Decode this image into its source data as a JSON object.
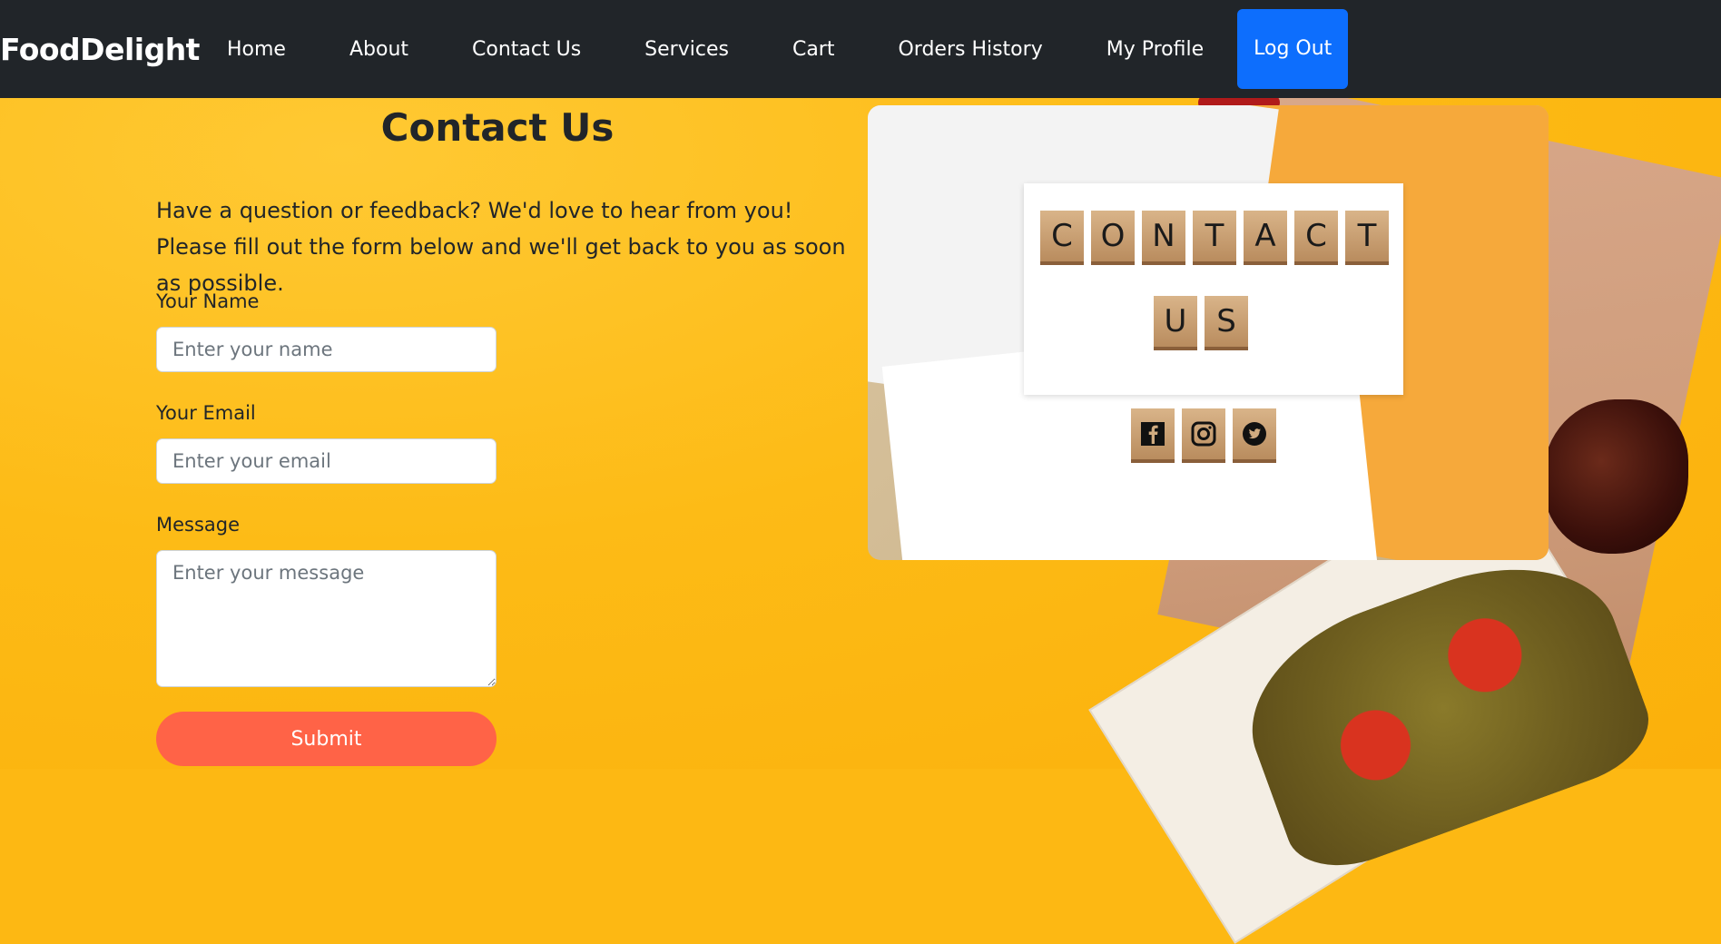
{
  "nav": {
    "brand": "FoodDelight",
    "items": [
      {
        "label": "Home"
      },
      {
        "label": "About"
      },
      {
        "label": "Contact Us"
      },
      {
        "label": "Services"
      },
      {
        "label": "Cart"
      },
      {
        "label": "Orders History"
      },
      {
        "label": "My Profile"
      }
    ],
    "logout_label": "Log Out"
  },
  "contact": {
    "title": "Contact Us",
    "intro": "Have a question or feedback? We'd love to hear from you! Please fill out the form below and we'll get back to you as soon as possible.",
    "name_label": "Your Name",
    "name_placeholder": "Enter your name",
    "email_label": "Your Email",
    "email_placeholder": "Enter your email",
    "message_label": "Message",
    "message_placeholder": "Enter your message",
    "submit_label": "Submit"
  },
  "image": {
    "tiles_row1": [
      "C",
      "O",
      "N",
      "T",
      "A",
      "C",
      "T"
    ],
    "tiles_row2": [
      "U",
      "S"
    ],
    "social_icons": [
      "facebook-icon",
      "instagram-icon",
      "twitter-icon"
    ]
  },
  "colors": {
    "navbar": "#212529",
    "logout": "#0d6efd",
    "submit": "#ff6347",
    "background": "#fdb813"
  }
}
